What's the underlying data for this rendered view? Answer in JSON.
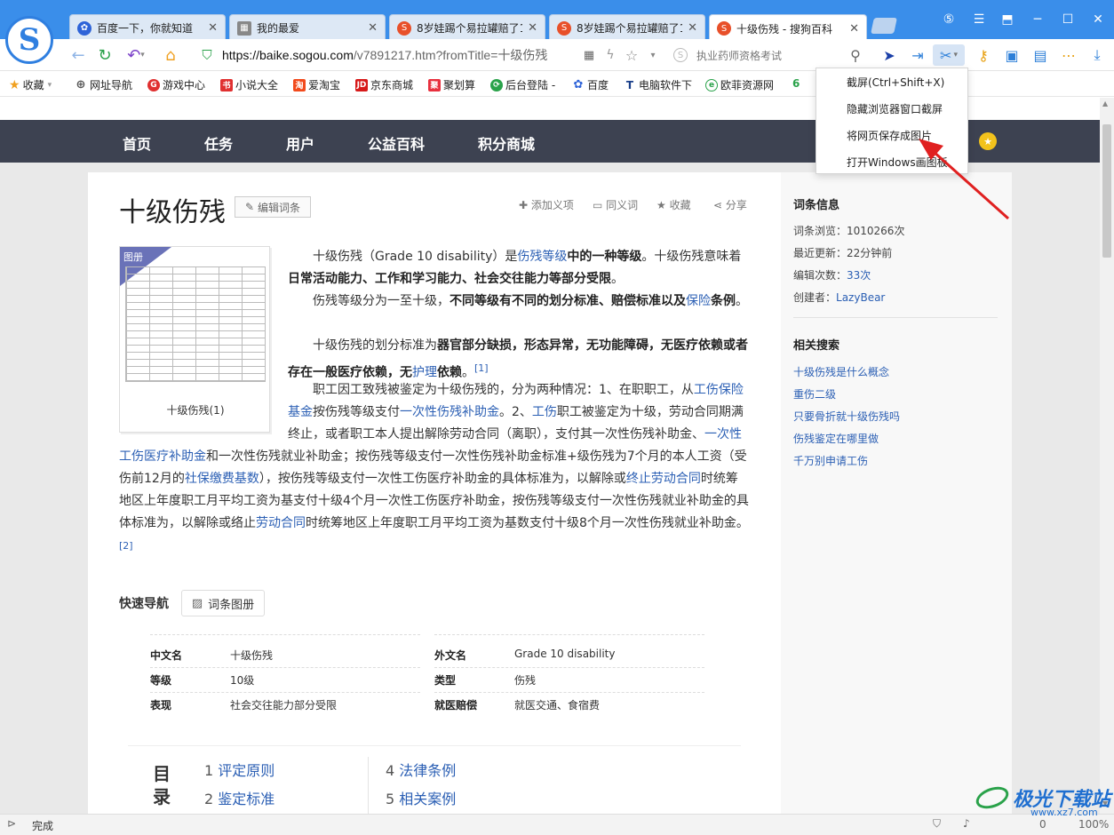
{
  "tabs": [
    {
      "title": "百度一下，你就知道",
      "icon": "baidu-icon"
    },
    {
      "title": "我的最爱",
      "icon": "grid-icon"
    },
    {
      "title": "8岁娃踢个易拉罐赔了1",
      "icon": "sogou-icon"
    },
    {
      "title": "8岁娃踢个易拉罐赔了1",
      "icon": "sogou-icon"
    },
    {
      "title": "十级伤残 - 搜狗百科",
      "icon": "sogou-icon"
    }
  ],
  "address": {
    "host": "https://baike.sogou.com",
    "path": "/v7891217.htm?fromTitle=十级伤残"
  },
  "search_placeholder": "执业药师资格考试",
  "bookmarks": [
    "收藏",
    "网址导航",
    "游戏中心",
    "小说大全",
    "爱淘宝",
    "京东商城",
    "聚划算",
    "后台登陆 -",
    "百度",
    "电脑软件下",
    "欧菲资源网"
  ],
  "site_nav": [
    "首页",
    "任务",
    "用户",
    "公益百科",
    "积分商城"
  ],
  "article": {
    "title": "十级伤残",
    "edit_label": "编辑词条",
    "actions": [
      "添加义项",
      "同义词",
      "收藏",
      "分享"
    ],
    "figure_badge": "图册",
    "figure_caption": "十级伤残(1)",
    "quick_nav_label": "快速导航",
    "album_button": "词条图册"
  },
  "info_table": [
    {
      "k": "中文名",
      "v": "十级伤残"
    },
    {
      "k": "外文名",
      "v": "Grade 10 disability"
    },
    {
      "k": "等级",
      "v": "10级"
    },
    {
      "k": "类型",
      "v": "伤残"
    },
    {
      "k": "表现",
      "v": "社会交往能力部分受限"
    },
    {
      "k": "就医赔偿",
      "v": "就医交通、食宿费"
    }
  ],
  "toc": {
    "badge": "目录",
    "items": [
      {
        "n": "1",
        "t": "评定原则"
      },
      {
        "n": "2",
        "t": "鉴定标准"
      },
      {
        "n": "4",
        "t": "法律条例"
      },
      {
        "n": "5",
        "t": "相关案例"
      }
    ]
  },
  "sidebar": {
    "info_title": "词条信息",
    "views": "词条浏览：1010266次",
    "updated": "最近更新：22分钟前",
    "edits_label": "编辑次数：",
    "edits_value": "33次",
    "creator_label": "创建者：",
    "creator_value": "LazyBear",
    "related_title": "相关搜索",
    "related": [
      "十级伤残是什么概念",
      "重伤二级",
      "只要骨折就十级伤残吗",
      "伤残鉴定在哪里做",
      "千万别申请工伤"
    ]
  },
  "menu": [
    "截屏(Ctrl+Shift+X)",
    "隐藏浏览器窗口截屏",
    "将网页保存成图片",
    "打开Windows画图板"
  ],
  "status": {
    "text": "完成",
    "count": "0",
    "zoom": "100%"
  },
  "watermark": {
    "brand": "极光下载站",
    "url": "www.xz7.com"
  },
  "colors": {
    "titlebar": "#3a8eea",
    "site_nav": "#3d4251",
    "link": "#2b5fb4",
    "arrow": "#e02020"
  }
}
